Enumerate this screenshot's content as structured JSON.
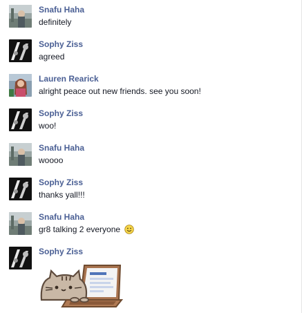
{
  "messages": [
    {
      "sender": "Snafu Haha",
      "text": "definitely",
      "avatar": "snafu"
    },
    {
      "sender": "Sophy Ziss",
      "text": "agreed",
      "avatar": "sophy"
    },
    {
      "sender": "Lauren Rearick",
      "text": "alright peace out new friends. see you soon!",
      "avatar": "lauren"
    },
    {
      "sender": "Sophy Ziss",
      "text": "woo!",
      "avatar": "sophy"
    },
    {
      "sender": "Snafu Haha",
      "text": "woooo",
      "avatar": "snafu"
    },
    {
      "sender": "Sophy Ziss",
      "text": "thanks yall!!!",
      "avatar": "sophy"
    },
    {
      "sender": "Snafu Haha",
      "text": "gr8 talking 2 everyone",
      "avatar": "snafu",
      "emoji": "smiley-emoji"
    },
    {
      "sender": "Sophy Ziss",
      "text": "",
      "avatar": "sophy",
      "sticker": "pusheen-cat-laptop-sticker"
    }
  ],
  "colors": {
    "sender_name": "#4a5f94",
    "message_text": "#141823",
    "divider": "#e3e3e3"
  }
}
